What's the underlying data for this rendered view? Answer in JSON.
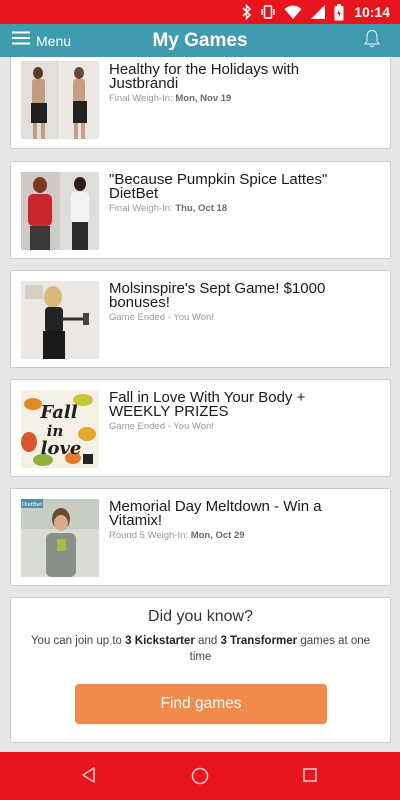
{
  "status_bar": {
    "time": "10:14",
    "icons": [
      "bluetooth-icon",
      "vibrate-icon",
      "wifi-icon",
      "signal-icon",
      "battery-icon"
    ],
    "color": "#e8161c"
  },
  "app_bar": {
    "menu_label": "Menu",
    "title": "My Games",
    "color": "#3f9bae",
    "icons": [
      "hamburger-menu-icon",
      "bell-icon"
    ]
  },
  "games": [
    {
      "title_lines": [
        "Healthy for the Holidays with",
        "Justbrandi"
      ],
      "status_label": "Final Weigh-In:",
      "status_value": "Mon, Nov 19"
    },
    {
      "title_lines": [
        "\"Because Pumpkin Spice Lattes\"",
        "DietBet"
      ],
      "status_label": "Final Weigh-In:",
      "status_value": "Thu, Oct 18"
    },
    {
      "title_lines": [
        "Molsinspire's Sept Game! $1000",
        "bonuses!"
      ],
      "status_label": "Game Ended - You Won!",
      "status_value": ""
    },
    {
      "title_lines": [
        "Fall in Love With Your Body +",
        "WEEKLY PRIZES"
      ],
      "status_label": "Game Ended - You Won!",
      "status_value": "",
      "thumb_text": [
        "Fall",
        "in",
        "love"
      ]
    },
    {
      "title_lines": [
        "Memorial Day Meltdown - Win a",
        "Vitamix!"
      ],
      "status_label": "Round 5 Weigh-In:",
      "status_value": "Mon, Oct 29",
      "thumb_badge": "DietBet"
    }
  ],
  "info": {
    "title": "Did you know?",
    "text_1": "You can join up to ",
    "count_1": "3",
    "type_1": "Kickstarter",
    "text_2": " and ",
    "count_2": "3",
    "type_2": "Transformer",
    "text_3": " games at one time",
    "button_label": "Find games",
    "button_color": "#f18a4b"
  },
  "nav_bar": {
    "icons": [
      "back-icon",
      "home-icon",
      "recents-icon"
    ],
    "color": "#e8161c"
  }
}
